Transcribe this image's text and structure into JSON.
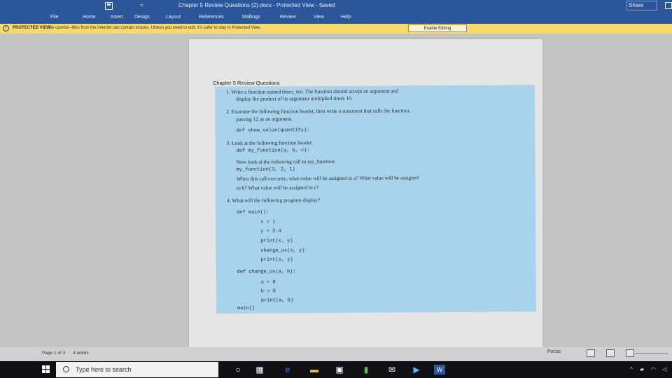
{
  "titlebar": {
    "title": "Chapter 5 Review Questions (2).docx  -  Protected View  -  Saved",
    "qa": "=",
    "share": "Share"
  },
  "ribbon": {
    "tabs": [
      "File",
      "Home",
      "Insert",
      "Design",
      "Layout",
      "References",
      "Mailings",
      "Review",
      "View",
      "Help"
    ]
  },
  "protected_view": {
    "label": "PROTECTED VIEW",
    "message": "Be careful—files from the Internet can contain viruses. Unless you need to edit, it's safer to stay in Protected View.",
    "button": "Enable Editing"
  },
  "document": {
    "heading": "Chapter 5 Review Questions",
    "lines": [
      {
        "text": "1.  Write a function named times_ten. The function should accept an argument and",
        "style": "serif",
        "indent": 0
      },
      {
        "text": "display the product of its argument multiplied times 10.",
        "style": "serif",
        "indent": 14
      },
      {
        "text": "2.  Examine the following function header, then write a statement that calls the function,",
        "style": "serif",
        "indent": 0
      },
      {
        "text": "passing 12 as an argument.",
        "style": "serif",
        "indent": 14
      },
      {
        "text": "def show_value(quantity):",
        "style": "mono",
        "indent": 14
      },
      {
        "text": "3.  Look at the following function header:",
        "style": "serif",
        "indent": 0
      },
      {
        "text": "def my_function(a, b, c):",
        "style": "mono",
        "indent": 14
      },
      {
        "text": "Now look at the following call to my_function:",
        "style": "serif",
        "indent": 14
      },
      {
        "text": "my_function(3, 2, 1)",
        "style": "mono",
        "indent": 14
      },
      {
        "text": "When this call executes, what value will be assigned to a? What value will be assigned",
        "style": "serif",
        "indent": 14
      },
      {
        "text": "to b? What value will be assigned to c?",
        "style": "serif",
        "indent": 14
      },
      {
        "text": "4.  What will the following program display?",
        "style": "serif",
        "indent": 0
      },
      {
        "text": "def main():",
        "style": "mono",
        "indent": 14
      },
      {
        "text": "x = 1",
        "style": "mono",
        "indent": 48
      },
      {
        "text": "y = 3.4",
        "style": "mono",
        "indent": 48
      },
      {
        "text": "print(x, y)",
        "style": "mono",
        "indent": 48
      },
      {
        "text": "change_us(x, y)",
        "style": "mono",
        "indent": 48
      },
      {
        "text": "print(x, y)",
        "style": "mono",
        "indent": 48
      },
      {
        "text": "def change_us(a, b):",
        "style": "mono",
        "indent": 14
      },
      {
        "text": "a = 0",
        "style": "mono",
        "indent": 48
      },
      {
        "text": "b = 0",
        "style": "mono",
        "indent": 48
      },
      {
        "text": "print(a, b)",
        "style": "mono",
        "indent": 48
      },
      {
        "text": "main()",
        "style": "mono",
        "indent": 14
      }
    ]
  },
  "statusbar": {
    "page": "Page 1 of 3",
    "words": "4 words",
    "focus": "Focus"
  },
  "taskbar": {
    "search_placeholder": "Type here to search"
  },
  "colors": {
    "word_blue": "#2b579a",
    "protected_yellow": "#f8d96a",
    "question_box": "#a9d3ec"
  }
}
